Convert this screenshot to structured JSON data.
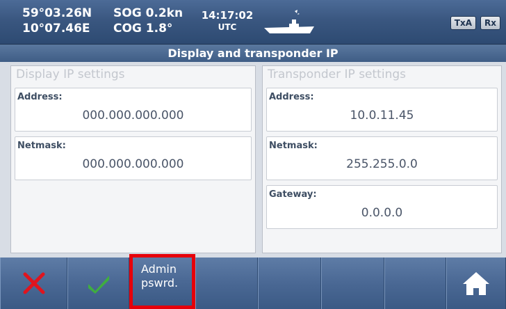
{
  "status": {
    "lat": "59°03.26N",
    "lon": "10°07.46E",
    "sog": "SOG 0.2kn",
    "cog": "COG 1.8°",
    "time": "14:17:02",
    "tz": "UTC",
    "txa": "TxA",
    "rx": "Rx"
  },
  "title": "Display and transponder IP",
  "display_panel": {
    "title": "Display IP settings",
    "address_label": "Address:",
    "address_value": "000.000.000.000",
    "netmask_label": "Netmask:",
    "netmask_value": "000.000.000.000"
  },
  "transponder_panel": {
    "title": "Transponder IP settings",
    "address_label": "Address:",
    "address_value": "10.0.11.45",
    "netmask_label": "Netmask:",
    "netmask_value": "255.255.0.0",
    "gateway_label": "Gateway:",
    "gateway_value": "0.0.0.0"
  },
  "buttons": {
    "admin_line1": "Admin",
    "admin_line2": "pswrd.",
    "cancel_icon": "close-icon",
    "confirm_icon": "checkmark-icon",
    "home_icon": "home-icon"
  },
  "colors": {
    "highlight": "#e6000a",
    "cancel": "#e0141e",
    "confirm": "#3fae3f"
  }
}
